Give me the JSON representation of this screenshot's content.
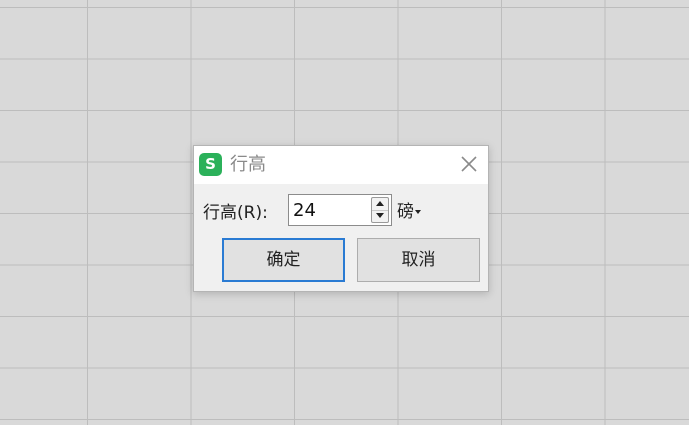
{
  "dialog": {
    "title": "行高",
    "app_icon_letter": "S",
    "field_label": "行高(R):",
    "value": "24",
    "unit": "磅",
    "ok_label": "确定",
    "cancel_label": "取消"
  },
  "icons": {
    "app": "wps-spreadsheet-icon",
    "close": "close-icon",
    "spin_up": "spin-up-arrow-icon",
    "spin_down": "spin-down-arrow-icon",
    "unit_dropdown": "caret-down-icon"
  },
  "colors": {
    "background": "#d9d9d9",
    "gridline": "#bdbdbd",
    "app_icon": "#2bb15a",
    "focus_border": "#2a7bd3"
  }
}
